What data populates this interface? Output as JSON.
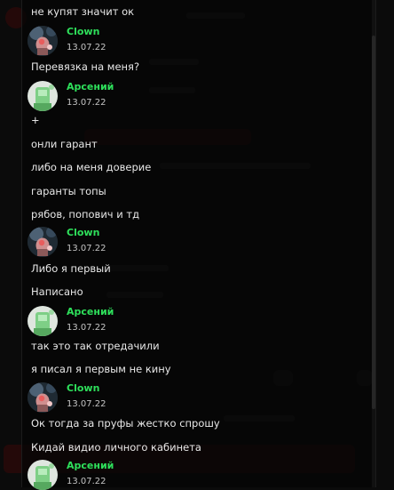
{
  "chat": {
    "messages": [
      {
        "type": "text",
        "text": "не купят значит ок"
      },
      {
        "type": "author",
        "name": "Clown",
        "time": "13.07.22",
        "avatar": "clown-avatar"
      },
      {
        "type": "text",
        "text": "Перевязка на меня?"
      },
      {
        "type": "author",
        "name": "Арсений",
        "time": "13.07.22",
        "avatar": "arseniy-avatar"
      },
      {
        "type": "text",
        "text": "+"
      },
      {
        "type": "text",
        "text": "онли гарант"
      },
      {
        "type": "text",
        "text": "либо на меня доверие"
      },
      {
        "type": "text",
        "text": "гаранты топы"
      },
      {
        "type": "text",
        "text": "рябов, попович и тд"
      },
      {
        "type": "author",
        "name": "Clown",
        "time": "13.07.22",
        "avatar": "clown-avatar"
      },
      {
        "type": "text",
        "text": "Либо я первый"
      },
      {
        "type": "text",
        "text": "Написано"
      },
      {
        "type": "author",
        "name": "Арсений",
        "time": "13.07.22",
        "avatar": "arseniy-avatar"
      },
      {
        "type": "text",
        "text": "так это так отредачили"
      },
      {
        "type": "text",
        "text": "я писал я первым не кину"
      },
      {
        "type": "author",
        "name": "Clown",
        "time": "13.07.22",
        "avatar": "clown-avatar"
      },
      {
        "type": "text",
        "text": "Ок тогда за пруфы жестко спрошу"
      },
      {
        "type": "text",
        "text": "Кидай видио личного кабинета"
      },
      {
        "type": "author",
        "name": "Арсений",
        "time": "13.07.22",
        "avatar": "arseniy-avatar"
      }
    ]
  },
  "colors": {
    "author_name": "#2ee05b",
    "background": "#0b0b0b",
    "text": "#e8e8e8"
  }
}
